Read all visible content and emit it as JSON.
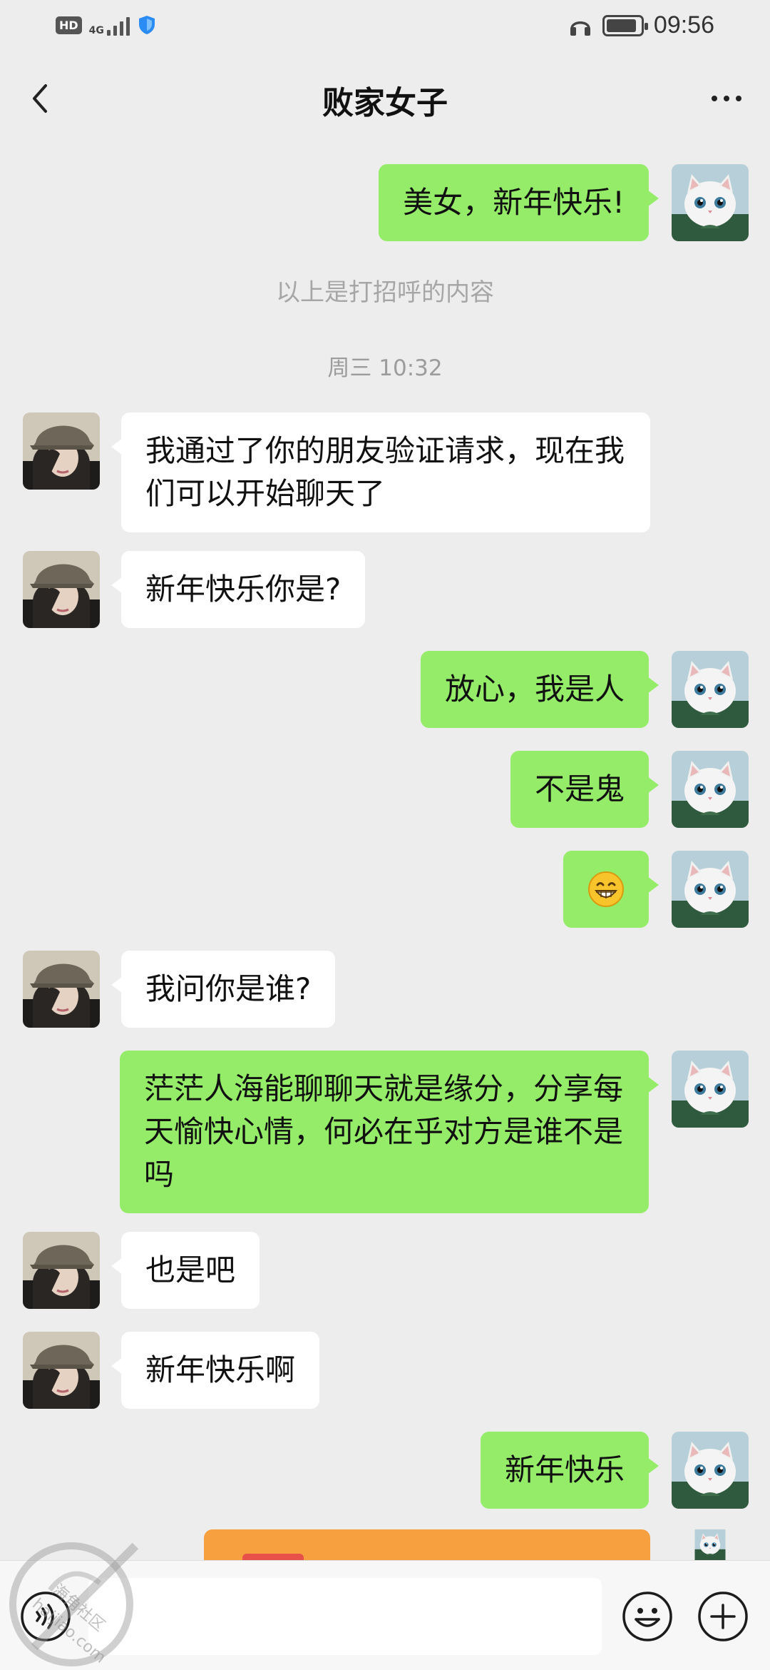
{
  "status_bar": {
    "hd": "HD",
    "network": "4G",
    "time": "09:56",
    "battery_level": 0.9
  },
  "header": {
    "title": "败家女子"
  },
  "messages": [
    {
      "side": "self",
      "text": "美女，新年快乐!"
    },
    {
      "side": "system",
      "text": "以上是打招呼的内容"
    },
    {
      "side": "time",
      "text": "周三 10:32"
    },
    {
      "side": "peer",
      "text": "我通过了你的朋友验证请求，现在我们可以开始聊天了"
    },
    {
      "side": "peer",
      "text": "新年快乐你是?"
    },
    {
      "side": "self",
      "text": "放心，我是人"
    },
    {
      "side": "self",
      "text": "不是鬼"
    },
    {
      "side": "self",
      "text": "",
      "emoji": "grin-emoji"
    },
    {
      "side": "peer",
      "text": "我问你是谁?"
    },
    {
      "side": "self",
      "text": "茫茫人海能聊聊天就是缘分，分享每天愉快心情，何必在乎对方是谁不是吗"
    },
    {
      "side": "peer",
      "text": "也是吧"
    },
    {
      "side": "peer",
      "text": "新年快乐啊"
    },
    {
      "side": "self",
      "text": "新年快乐"
    }
  ],
  "watermark": {
    "text": "海角社区",
    "domain": "haijiao.com"
  },
  "colors": {
    "self_bubble": "#95ec69",
    "peer_bubble": "#ffffff",
    "background": "#ededed"
  },
  "icons": {
    "back": "chevron-left-icon",
    "more": "more-dots-icon",
    "voice": "voice-icon",
    "emoji": "emoji-icon",
    "plus": "plus-icon"
  }
}
